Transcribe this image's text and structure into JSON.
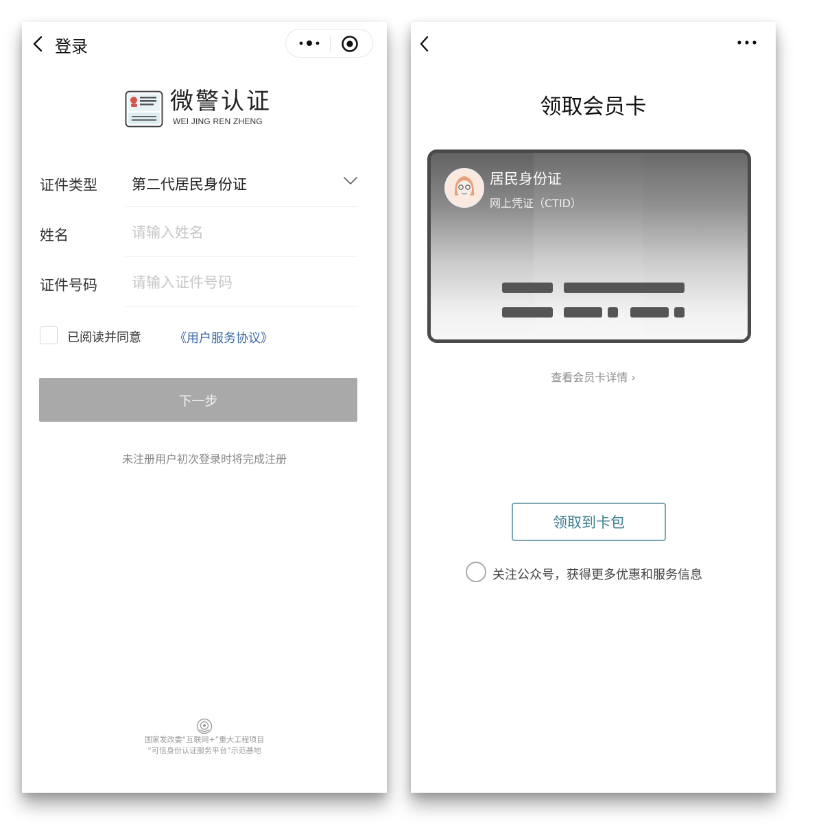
{
  "login": {
    "nav_title": "登录",
    "logo_title": "微警认证",
    "logo_subtitle": "WEI  JING REN ZHENG",
    "id_type_label": "证件类型",
    "id_type_value": "第二代居民身份证",
    "name_label": "姓名",
    "name_placeholder": "请输入姓名",
    "id_number_label": "证件号码",
    "id_number_placeholder": "请输入证件号码",
    "agree_text": "已阅读并同意",
    "agree_link": "《用户服务协议》",
    "next_button": "下一步",
    "tip": "未注册用户初次登录时将完成注册",
    "footer_line1": "国家发改委“互联网+”重大工程项目",
    "footer_line2": "“可信身份认证服务平台”示范基地",
    "colors": {
      "button_disabled": "#a9a9a9",
      "link": "#3b6aa5"
    }
  },
  "member": {
    "page_title": "领取会员卡",
    "card_name": "居民身份证",
    "card_subtitle": "网上凭证（CTID）",
    "detail_link": "查看会员卡详情 ›",
    "claim_button": "领取到卡包",
    "follow_text": "关注公众号，获得更多优惠和服务信息",
    "colors": {
      "claim_accent": "#3d7f90"
    }
  },
  "icons": [
    "back-icon",
    "more-icon",
    "target-icon",
    "chevron-down-icon",
    "id-card-logo-icon",
    "police-emblem-icon",
    "avatar-icon"
  ]
}
